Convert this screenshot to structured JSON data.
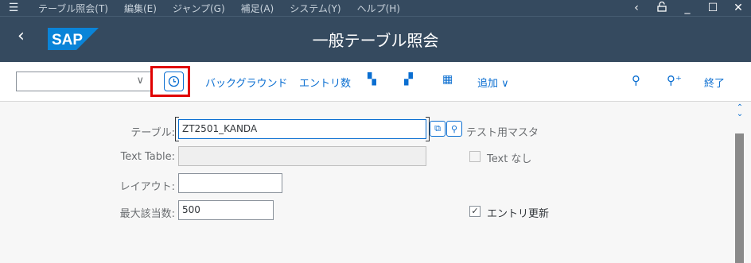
{
  "menubar": {
    "items": [
      "テーブル照会(T)",
      "編集(E)",
      "ジャンプ(G)",
      "補足(A)",
      "システム(Y)",
      "ヘルプ(H)"
    ]
  },
  "titlebar": {
    "logo": "SAP",
    "title": "一般テーブル照会"
  },
  "toolbar": {
    "background_label": "バックグラウンド",
    "entry_count_label": "エントリ数",
    "add_label": "追加 ∨",
    "exit_label": "終了"
  },
  "form": {
    "table_label": "テーブル:",
    "table_value": "ZT2501_KANDA",
    "table_desc": "テスト用マスタ",
    "text_table_label": "Text Table:",
    "text_table_value": "",
    "no_text_label": "Text なし",
    "layout_label": "レイアウト:",
    "layout_value": "",
    "max_hits_label": "最大該当数:",
    "max_hits_value": "500",
    "update_entries_label": "エントリ更新",
    "update_entries_checked": true
  },
  "colors": {
    "shell": "#354a5f",
    "accent": "#0a6ed1",
    "highlight": "#e00000"
  }
}
